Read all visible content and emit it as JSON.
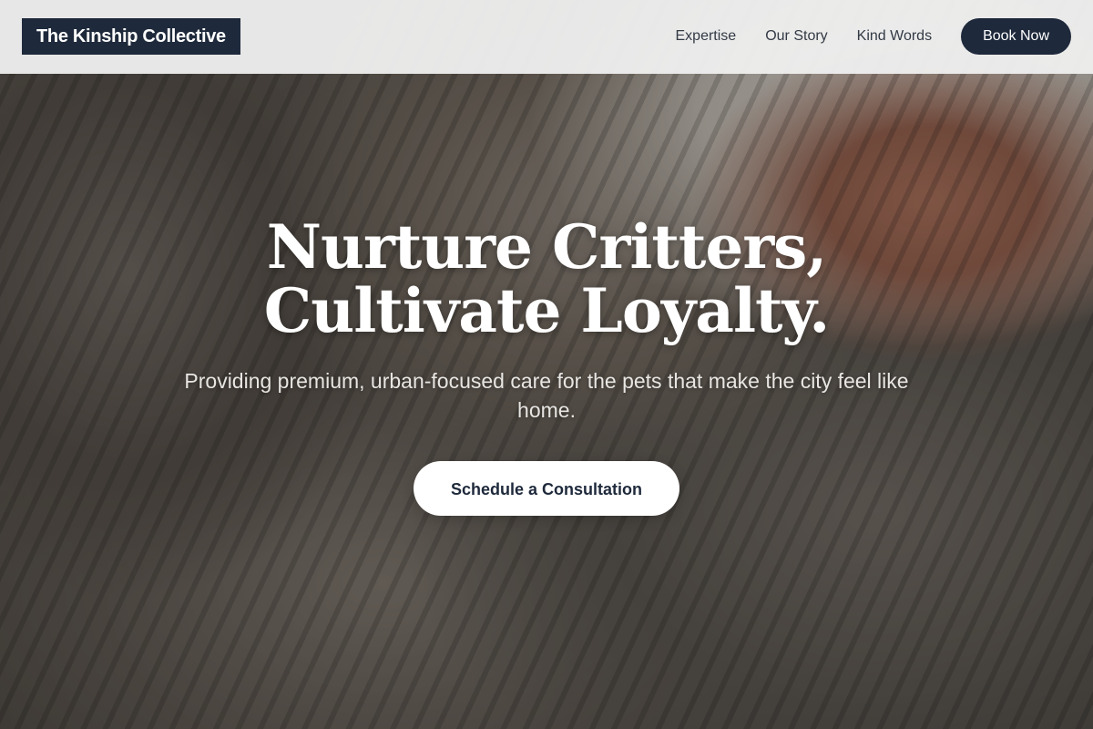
{
  "header": {
    "logo_text": "The Kinship Collective",
    "nav": [
      {
        "label": "Expertise"
      },
      {
        "label": "Our Story"
      },
      {
        "label": "Kind Words"
      }
    ],
    "cta_label": "Book Now"
  },
  "hero": {
    "title_line1": "Nurture Critters,",
    "title_line2": "Cultivate Loyalty.",
    "subtitle": "Providing premium, urban-focused care for the pets that make the city feel like home.",
    "cta_label": "Schedule a Consultation",
    "background_image": "tabby-cats-cuddling-photo"
  },
  "colors": {
    "brand_navy": "#1e293b",
    "header_bg": "#eeeeee",
    "hero_text": "#ffffff",
    "cta_bg": "#ffffff"
  }
}
